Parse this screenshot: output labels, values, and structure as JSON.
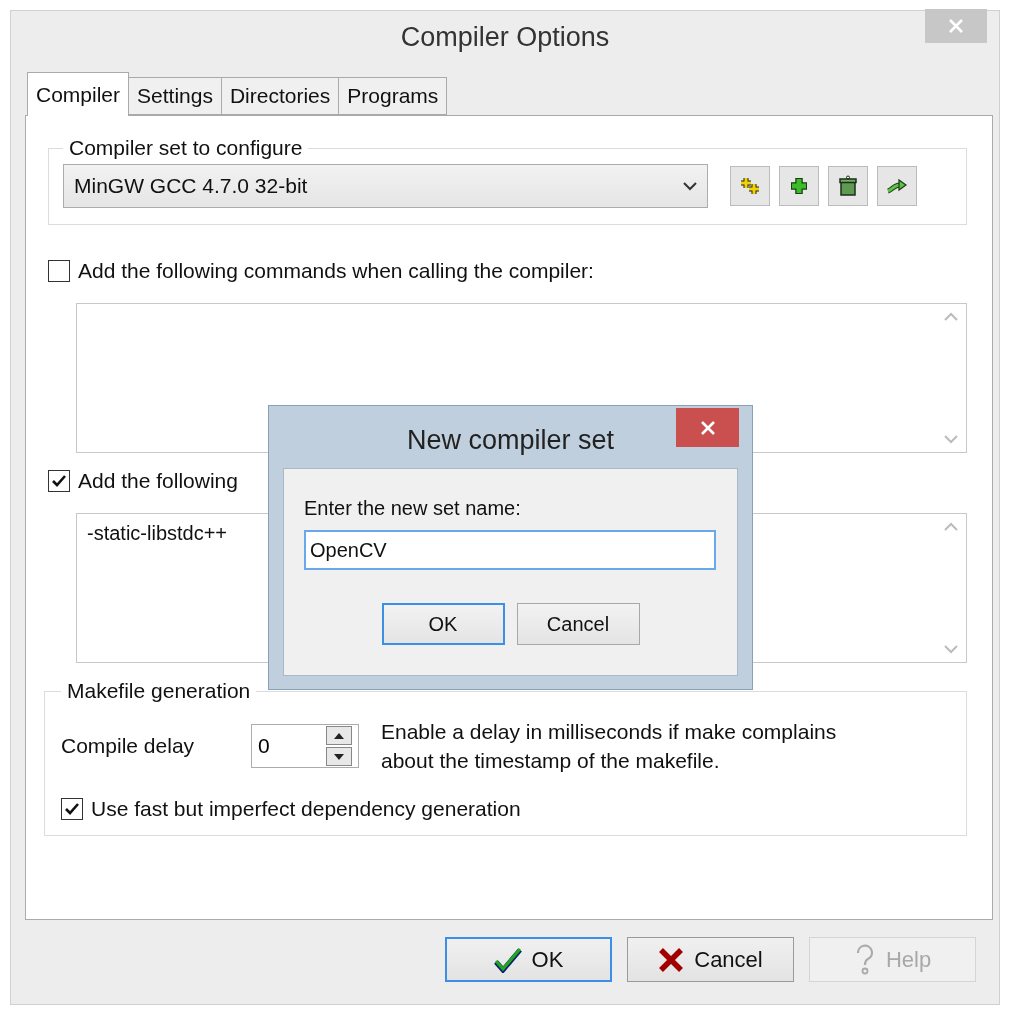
{
  "window": {
    "title": "Compiler Options"
  },
  "tabs": [
    {
      "label": "Compiler",
      "selected": true
    },
    {
      "label": "Settings",
      "selected": false
    },
    {
      "label": "Directories",
      "selected": false
    },
    {
      "label": "Programs",
      "selected": false
    }
  ],
  "compiler_set": {
    "legend": "Compiler set to configure",
    "value": "MinGW GCC 4.7.0 32-bit"
  },
  "compiler_commands": {
    "label": "Add the following commands when calling the compiler:",
    "checked": false
  },
  "linker_commands": {
    "label": "Add the following",
    "checked": true,
    "text": "-static-libstdc++"
  },
  "makefile": {
    "legend": "Makefile generation",
    "delay_label": "Compile delay",
    "delay_value": "0",
    "delay_hint": "Enable a delay in milliseconds if make complains about the timestamp of the makefile.",
    "fast_deps": {
      "label": "Use fast but imperfect dependency generation",
      "checked": true
    }
  },
  "buttons": [
    {
      "label": "OK",
      "kind": "ok",
      "focused": true,
      "disabled": false
    },
    {
      "label": "Cancel",
      "kind": "cancel",
      "focused": false,
      "disabled": false
    },
    {
      "label": "Help",
      "kind": "help",
      "focused": false,
      "disabled": true
    }
  ],
  "dialog": {
    "title": "New compiler set",
    "prompt": "Enter the new set name:",
    "value": "OpenCV",
    "buttons": [
      {
        "label": "OK",
        "focused": true
      },
      {
        "label": "Cancel",
        "focused": false
      }
    ]
  }
}
